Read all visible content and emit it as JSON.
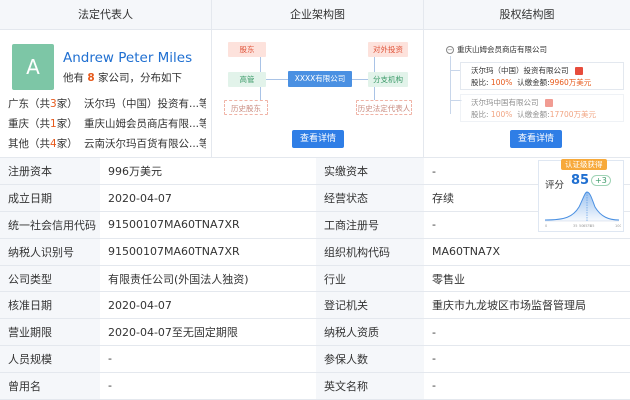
{
  "panels": {
    "legal_rep_title": "法定代表人",
    "org_title": "企业架构图",
    "share_title": "股权结构图"
  },
  "legal_rep": {
    "avatar_letter": "A",
    "name": "Andrew Peter Miles",
    "sub_prefix": "他有",
    "sub_count": "8",
    "sub_suffix": "家公司，分布如下",
    "regions": [
      {
        "region": "广东",
        "count": "3",
        "company": "沃尔玛（中国）投资有...等"
      },
      {
        "region": "重庆",
        "count": "1",
        "company": "重庆山姆会员商店有限...等"
      },
      {
        "region": "其他",
        "count": "4",
        "company": "云南沃尔玛百货有限公...等"
      }
    ],
    "region_open": "（共",
    "region_close": "家）"
  },
  "org": {
    "shareholder": "股东",
    "executive": "高管",
    "history_shareholder": "历史股东",
    "center": "XXXX有限公司",
    "outbound": "对外投资",
    "branch": "分支机构",
    "history_rep": "历史法定代表人",
    "detail_button": "查看详情"
  },
  "shares": {
    "root": "重庆山姆会员商店有限公司",
    "items": [
      {
        "name": "沃尔玛（中国）投资有限公司",
        "ratio_label": "股比:",
        "ratio": "100%",
        "sub_label": "认缴金额:",
        "sub_amount": "9960万美元"
      },
      {
        "name": "沃尔玛中国有限公司",
        "ratio_label": "股比:",
        "ratio": "100%",
        "sub_label": "认缴金额:",
        "sub_amount": "17700万美元"
      }
    ],
    "detail_button": "查看详情"
  },
  "score": {
    "badge": "认证级获得",
    "label": "评分",
    "value": "85",
    "delta": "+3",
    "axis": [
      "0",
      "35",
      "50",
      "65",
      "75",
      "85",
      "100"
    ]
  },
  "table": {
    "rows": [
      {
        "k1": "注册资本",
        "v1": "996万美元",
        "k2": "实缴资本",
        "v2": "-"
      },
      {
        "k1": "成立日期",
        "v1": "2020-04-07",
        "k2": "经营状态",
        "v2": "存续"
      },
      {
        "k1": "统一社会信用代码",
        "v1": "91500107MA60TNA7XR",
        "k2": "工商注册号",
        "v2": "-"
      },
      {
        "k1": "纳税人识别号",
        "v1": "91500107MA60TNA7XR",
        "k2": "组织机构代码",
        "v2": "MA60TNA7X"
      },
      {
        "k1": "公司类型",
        "v1": "有限责任公司(外国法人独资)",
        "k2": "行业",
        "v2": "零售业"
      },
      {
        "k1": "核准日期",
        "v1": "2020-04-07",
        "k2": "登记机关",
        "v2": "重庆市九龙坡区市场监督管理局"
      },
      {
        "k1": "营业期限",
        "v1": "2020-04-07至无固定期限",
        "k2": "纳税人资质",
        "v2": "-"
      },
      {
        "k1": "人员规模",
        "v1": "-",
        "k2": "参保人数",
        "v2": "-"
      },
      {
        "k1": "曾用名",
        "v1": "-",
        "k2": "英文名称",
        "v2": "-"
      }
    ]
  }
}
